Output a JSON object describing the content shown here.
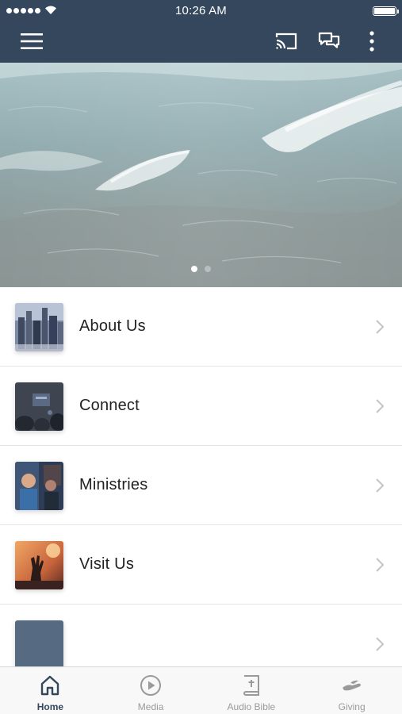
{
  "status_bar": {
    "time": "10:26 AM"
  },
  "nav": {
    "menu_icon": "hamburger-icon",
    "actions": [
      {
        "icon": "cast-icon"
      },
      {
        "icon": "chat-bubbles-icon"
      },
      {
        "icon": "more-vertical-icon"
      }
    ]
  },
  "hero": {
    "page_indicator": {
      "current": 1,
      "total": 2
    }
  },
  "menu_items": [
    {
      "label": "About Us",
      "thumb": "city-skyline"
    },
    {
      "label": "Connect",
      "thumb": "dark-room"
    },
    {
      "label": "Ministries",
      "thumb": "speaker"
    },
    {
      "label": "Visit Us",
      "thumb": "worship-hands"
    },
    {
      "label": "",
      "thumb": "blank"
    }
  ],
  "tabs": [
    {
      "label": "Home",
      "icon": "home-icon",
      "active": true
    },
    {
      "label": "Media",
      "icon": "play-circle-icon",
      "active": false
    },
    {
      "label": "Audio Bible",
      "icon": "bible-icon",
      "active": false
    },
    {
      "label": "Giving",
      "icon": "giving-hand-icon",
      "active": false
    }
  ],
  "colors": {
    "header": "#34475c",
    "active_tab": "#34475c",
    "inactive_tab": "#9a9a9a"
  }
}
